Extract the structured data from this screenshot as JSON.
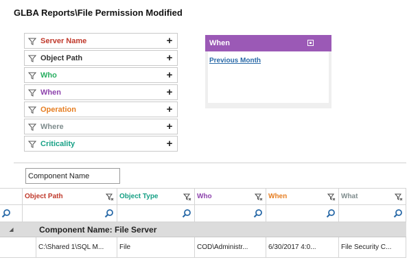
{
  "page_title": "GLBA Reports\\File Permission Modified",
  "filters": [
    {
      "label": "Server Name",
      "color": "#c0392b"
    },
    {
      "label": "Object Path",
      "color": "#333333"
    },
    {
      "label": "Who",
      "color": "#27ae60"
    },
    {
      "label": "When",
      "color": "#8e44ad"
    },
    {
      "label": "Operation",
      "color": "#e67e22"
    },
    {
      "label": "Where",
      "color": "#7f8c8d"
    },
    {
      "label": "Criticality",
      "color": "#16a085"
    }
  ],
  "add_icon": "+",
  "when_panel": {
    "title": "When",
    "link": "Previous Month",
    "header_color": "#9b59b6"
  },
  "group_by": {
    "value": "Component Name"
  },
  "grid": {
    "columns": [
      {
        "label": "Object Path",
        "color": "#c0392b"
      },
      {
        "label": "Object Type",
        "color": "#16a085"
      },
      {
        "label": "Who",
        "color": "#8e44ad"
      },
      {
        "label": "When",
        "color": "#e67e22"
      },
      {
        "label": "What",
        "color": "#7f8c8d"
      }
    ],
    "group_label": "Component Name: File Server",
    "rows": [
      [
        "C:\\Shared 1\\SQL M...",
        "File",
        "COD\\Administr...",
        "6/30/2017 4:0...",
        "File Security C..."
      ]
    ]
  }
}
